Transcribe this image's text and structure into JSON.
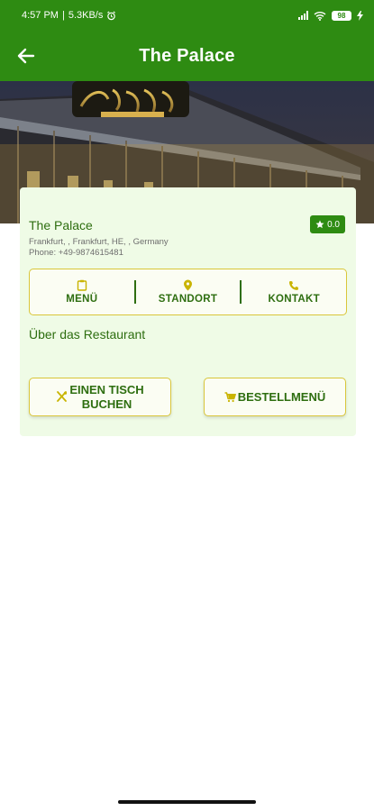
{
  "status_bar": {
    "time": "4:57 PM",
    "net_speed": "5.3KB/s",
    "battery": "98"
  },
  "app_bar": {
    "title": "The Palace",
    "back_icon": "arrow-left-icon"
  },
  "restaurant": {
    "name": "The Palace",
    "rating": "0.0",
    "address": "Frankfurt, , Frankfurt, HE, , Germany",
    "phone": "Phone: +49-9874615481"
  },
  "actions": [
    {
      "label": "MENÜ",
      "icon": "clipboard-icon"
    },
    {
      "label": "STANDORT",
      "icon": "location-pin-icon"
    },
    {
      "label": "KONTAKT",
      "icon": "phone-icon"
    }
  ],
  "about_label": "Über das Restaurant",
  "buttons": {
    "book_line1": "EINEN TISCH",
    "book_line2": "BUCHEN",
    "order_label": "BESTELLMENÜ"
  },
  "colors": {
    "primary": "#2e8b12",
    "text_green": "#2e6e10",
    "card_bg": "#effbe6",
    "accent_border": "#d9c63a",
    "icon_yellow": "#c9b400"
  }
}
